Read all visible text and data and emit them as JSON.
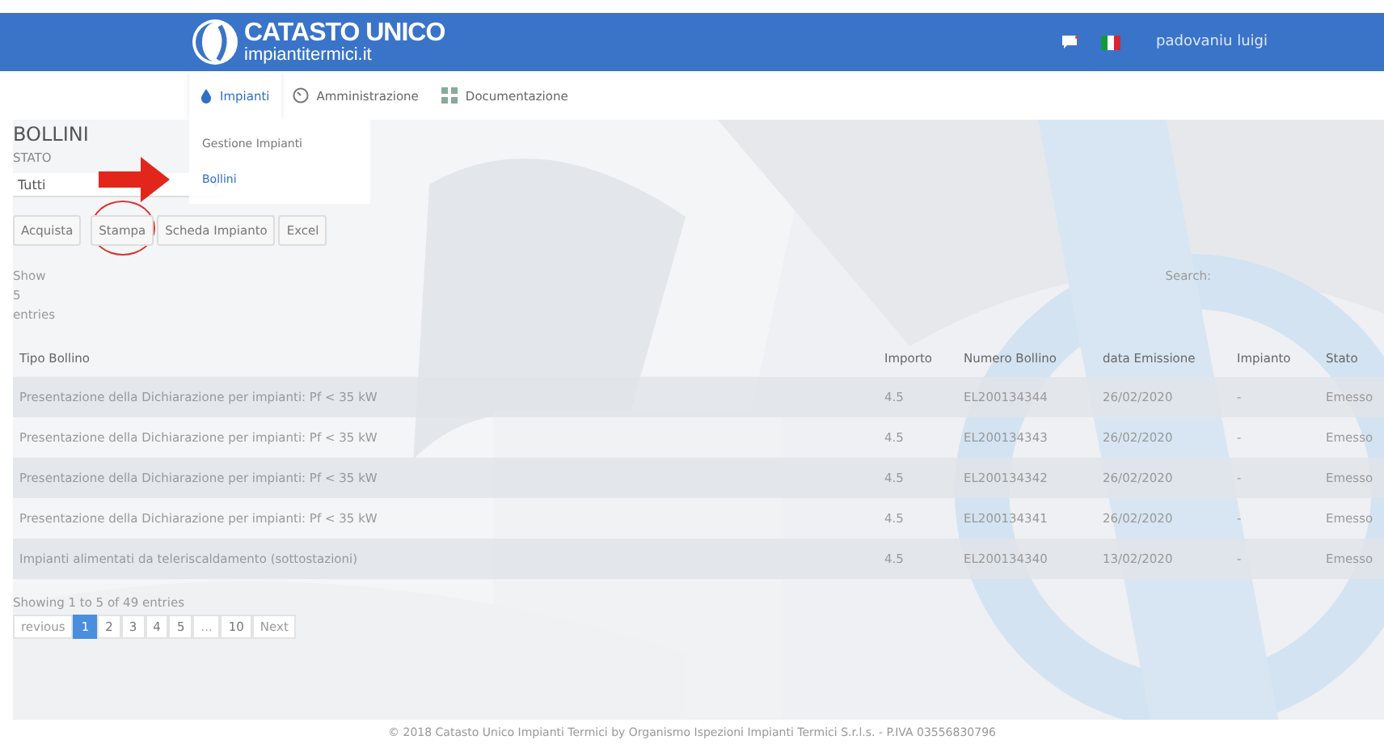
{
  "header": {
    "logo": {
      "title": "CATASTO UNICO",
      "subtitle": "impiantitermici.it"
    },
    "user": "padovaniu luigi"
  },
  "nav": {
    "items": [
      {
        "label": "Impianti",
        "selected": true
      },
      {
        "label": "Amministrazione",
        "selected": false
      },
      {
        "label": "Documentazione",
        "selected": false
      }
    ],
    "dropdown": [
      {
        "label": "Gestione Impianti",
        "selected": false,
        "arrowed": false
      },
      {
        "label": "Bollini",
        "selected": true,
        "arrowed": true
      }
    ]
  },
  "page": {
    "title": "BOLLINI",
    "filter": {
      "label": "STATO",
      "value": "Tutti"
    },
    "buttons": [
      {
        "label": "Acquista",
        "circled": false
      },
      {
        "label": "Stampa",
        "circled": true
      },
      {
        "label": "Scheda Impianto",
        "circled": false
      },
      {
        "label": "Excel",
        "circled": false
      }
    ],
    "length": {
      "show": "Show",
      "value": "5",
      "entries": "entries"
    },
    "search": "Search:"
  },
  "table": {
    "columns": [
      "Tipo Bollino",
      "Importo",
      "Numero Bollino",
      "data Emissione",
      "Impianto",
      "Stato"
    ],
    "rows": [
      [
        "Presentazione della Dichiarazione per impianti: Pf < 35 kW",
        "4.5",
        "EL200134344",
        "26/02/2020",
        "-",
        "Emesso"
      ],
      [
        "Presentazione della Dichiarazione per impianti: Pf < 35 kW",
        "4.5",
        "EL200134343",
        "26/02/2020",
        "-",
        "Emesso"
      ],
      [
        "Presentazione della Dichiarazione per impianti: Pf < 35 kW",
        "4.5",
        "EL200134342",
        "26/02/2020",
        "-",
        "Emesso"
      ],
      [
        "Presentazione della Dichiarazione per impianti: Pf < 35 kW",
        "4.5",
        "EL200134341",
        "26/02/2020",
        "-",
        "Emesso"
      ],
      [
        "Impianti alimentati da teleriscaldamento (sottostazioni)",
        "4.5",
        "EL200134340",
        "13/02/2020",
        "-",
        "Emesso"
      ]
    ]
  },
  "info": "Showing 1 to 5 of 49 entries",
  "pagination": [
    {
      "label": "revious",
      "kind": "nav",
      "selected": false
    },
    {
      "label": "1",
      "kind": "page",
      "selected": true
    },
    {
      "label": "2",
      "kind": "page",
      "selected": false
    },
    {
      "label": "3",
      "kind": "page",
      "selected": false
    },
    {
      "label": "4",
      "kind": "page",
      "selected": false
    },
    {
      "label": "5",
      "kind": "page",
      "selected": false
    },
    {
      "label": "...",
      "kind": "gap",
      "selected": false
    },
    {
      "label": "10",
      "kind": "page",
      "selected": false
    },
    {
      "label": "Next",
      "kind": "nav",
      "selected": false
    }
  ],
  "footer": "© 2018 Catasto Unico Impianti Termici by Organismo Ispezioni Impianti Termici S.r.l.s. - P.IVA 03556830796"
}
